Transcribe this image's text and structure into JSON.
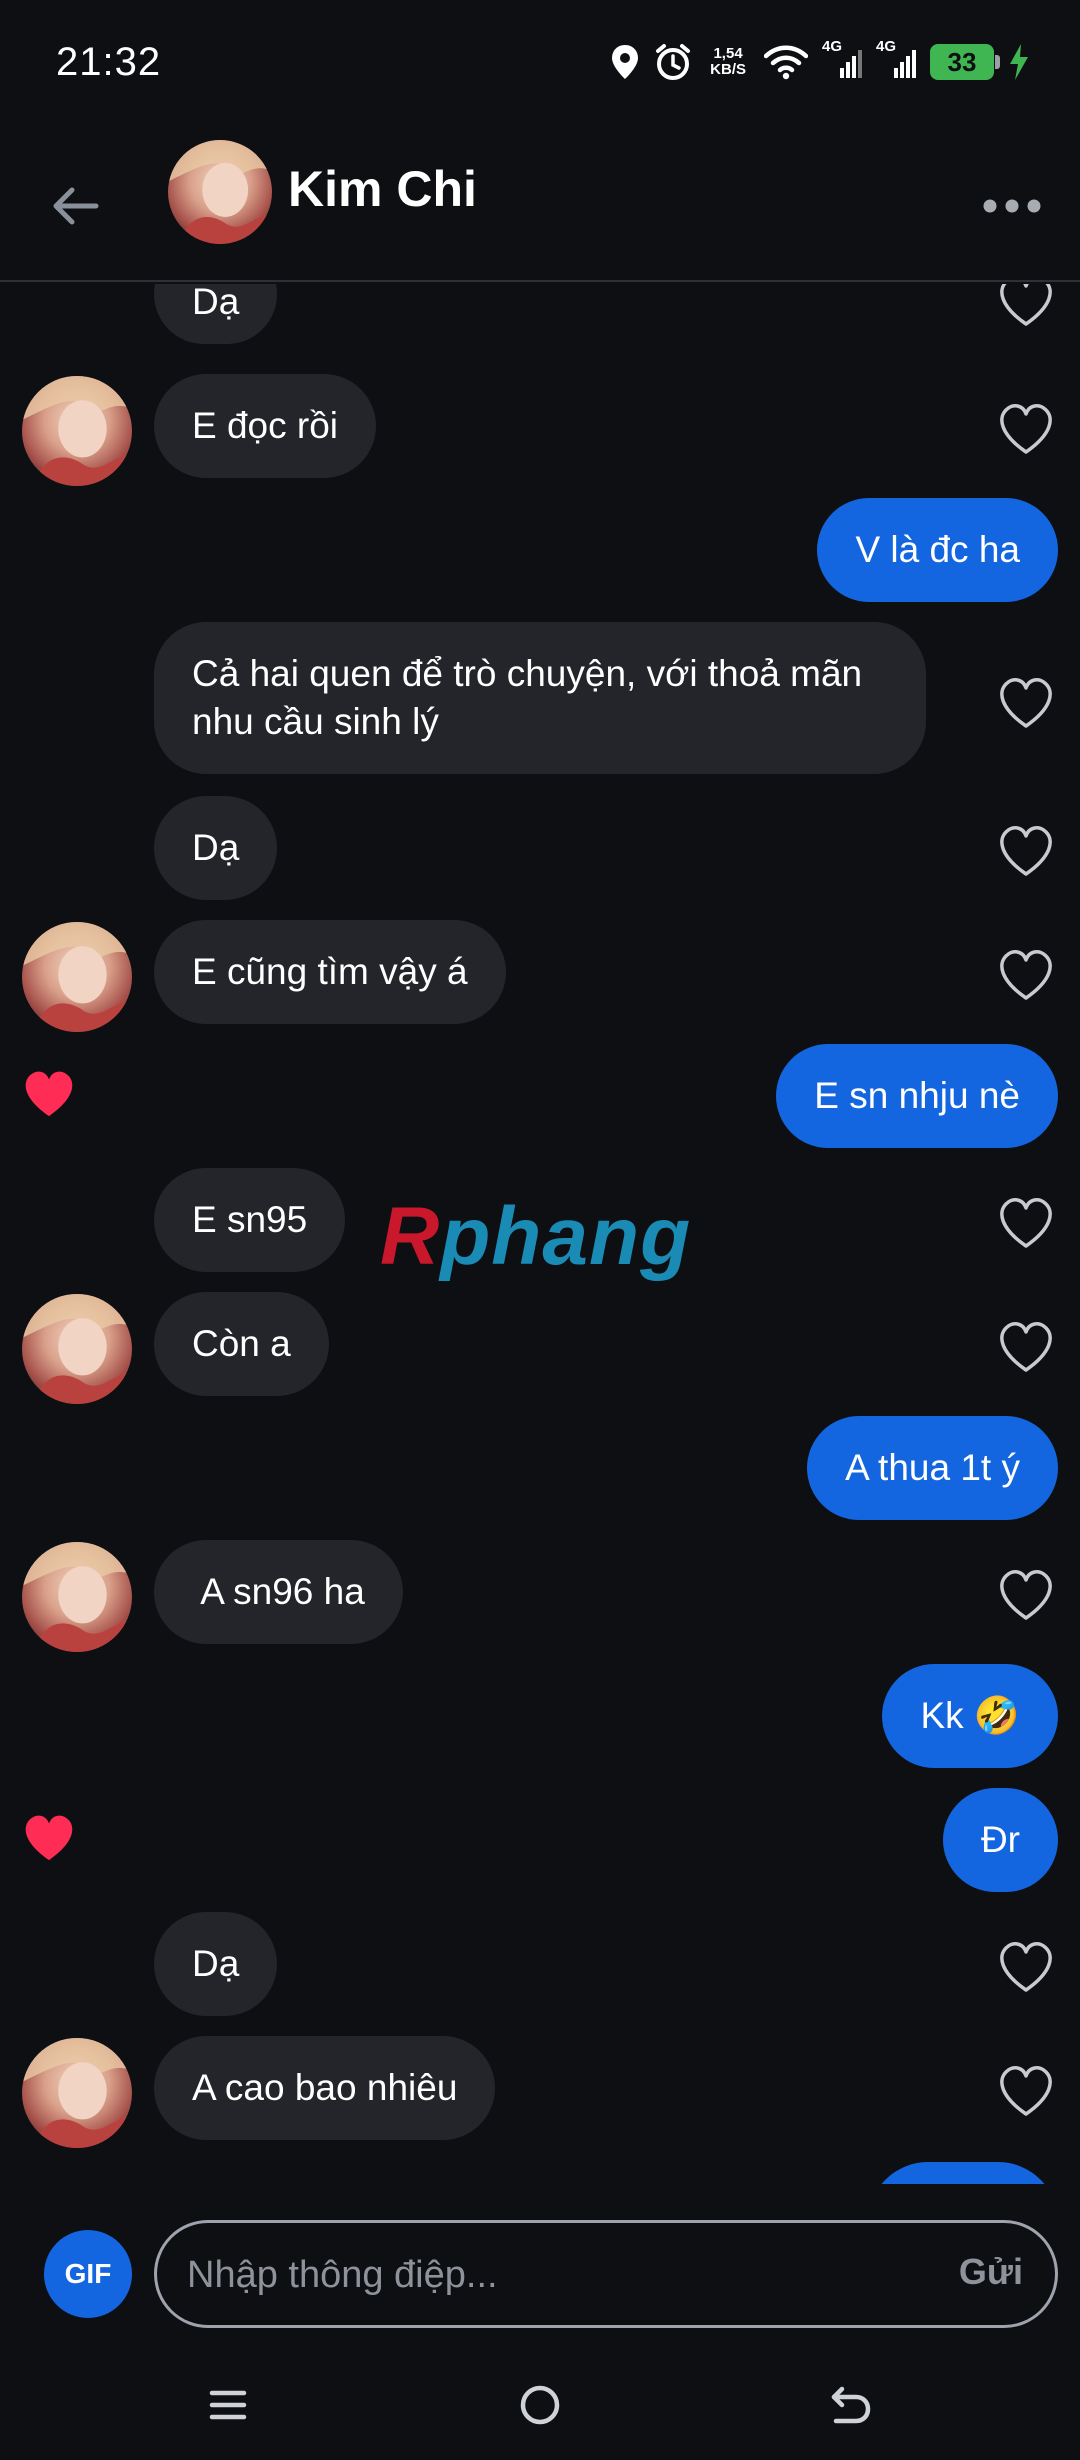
{
  "status": {
    "time": "21:32",
    "speed_value": "1,54",
    "speed_unit": "KB/S",
    "network_1": "4G",
    "network_2": "4G",
    "battery": "33",
    "icons": [
      "location-icon",
      "alarm-icon",
      "wifi-icon",
      "signal-icon",
      "signal-icon",
      "battery-icon",
      "charging-icon"
    ]
  },
  "header": {
    "contact_name": "Kim Chi",
    "icons": [
      "back-arrow-icon",
      "more-icon"
    ]
  },
  "watermark": {
    "part1": "R",
    "part2": "phang"
  },
  "messages": [
    {
      "id": "m1",
      "direction": "incoming",
      "text": "Dạ",
      "liked_by_me": false,
      "avatar": false
    },
    {
      "id": "m2",
      "direction": "incoming",
      "text": "E đọc rồi",
      "liked_by_me": false,
      "avatar": true
    },
    {
      "id": "m3",
      "direction": "outgoing",
      "text": "V là đc ha",
      "liked": false
    },
    {
      "id": "m4",
      "direction": "incoming",
      "text": "Cả hai quen để trò chuyện, với thoả mãn nhu cầu sinh lý",
      "liked_by_me": false,
      "avatar": false
    },
    {
      "id": "m5",
      "direction": "incoming",
      "text": "Dạ",
      "liked_by_me": false,
      "avatar": false
    },
    {
      "id": "m6",
      "direction": "incoming",
      "text": "E cũng tìm vậy á",
      "liked_by_me": false,
      "avatar": true
    },
    {
      "id": "m7",
      "direction": "outgoing",
      "text": "E sn nhju nè",
      "liked": true
    },
    {
      "id": "m8",
      "direction": "incoming",
      "text": "E sn95",
      "liked_by_me": false,
      "avatar": false
    },
    {
      "id": "m9",
      "direction": "incoming",
      "text": "Còn a",
      "liked_by_me": false,
      "avatar": true
    },
    {
      "id": "m10",
      "direction": "outgoing",
      "text": "A thua 1t ý",
      "liked": false
    },
    {
      "id": "m11",
      "direction": "incoming",
      "text": " A sn96 ha",
      "liked_by_me": false,
      "avatar": true
    },
    {
      "id": "m12",
      "direction": "outgoing",
      "text": "Kk 🤣",
      "liked": false
    },
    {
      "id": "m13",
      "direction": "outgoing",
      "text": "Đr",
      "liked": true
    },
    {
      "id": "m14",
      "direction": "incoming",
      "text": "Dạ",
      "liked_by_me": false,
      "avatar": false
    },
    {
      "id": "m15",
      "direction": "incoming",
      "text": "A cao bao nhiêu",
      "liked_by_me": false,
      "avatar": true
    }
  ],
  "composer": {
    "gif_label": "GIF",
    "placeholder": "Nhập thông điệp...",
    "value": "",
    "send_label": "Gửi"
  },
  "nav": {
    "icons": [
      "recent-apps-icon",
      "home-icon",
      "back-icon"
    ]
  },
  "colors": {
    "background": "#0e0f12",
    "incoming_bubble": "#24252a",
    "outgoing_bubble": "#1466e0",
    "like": "#ff2d55"
  }
}
